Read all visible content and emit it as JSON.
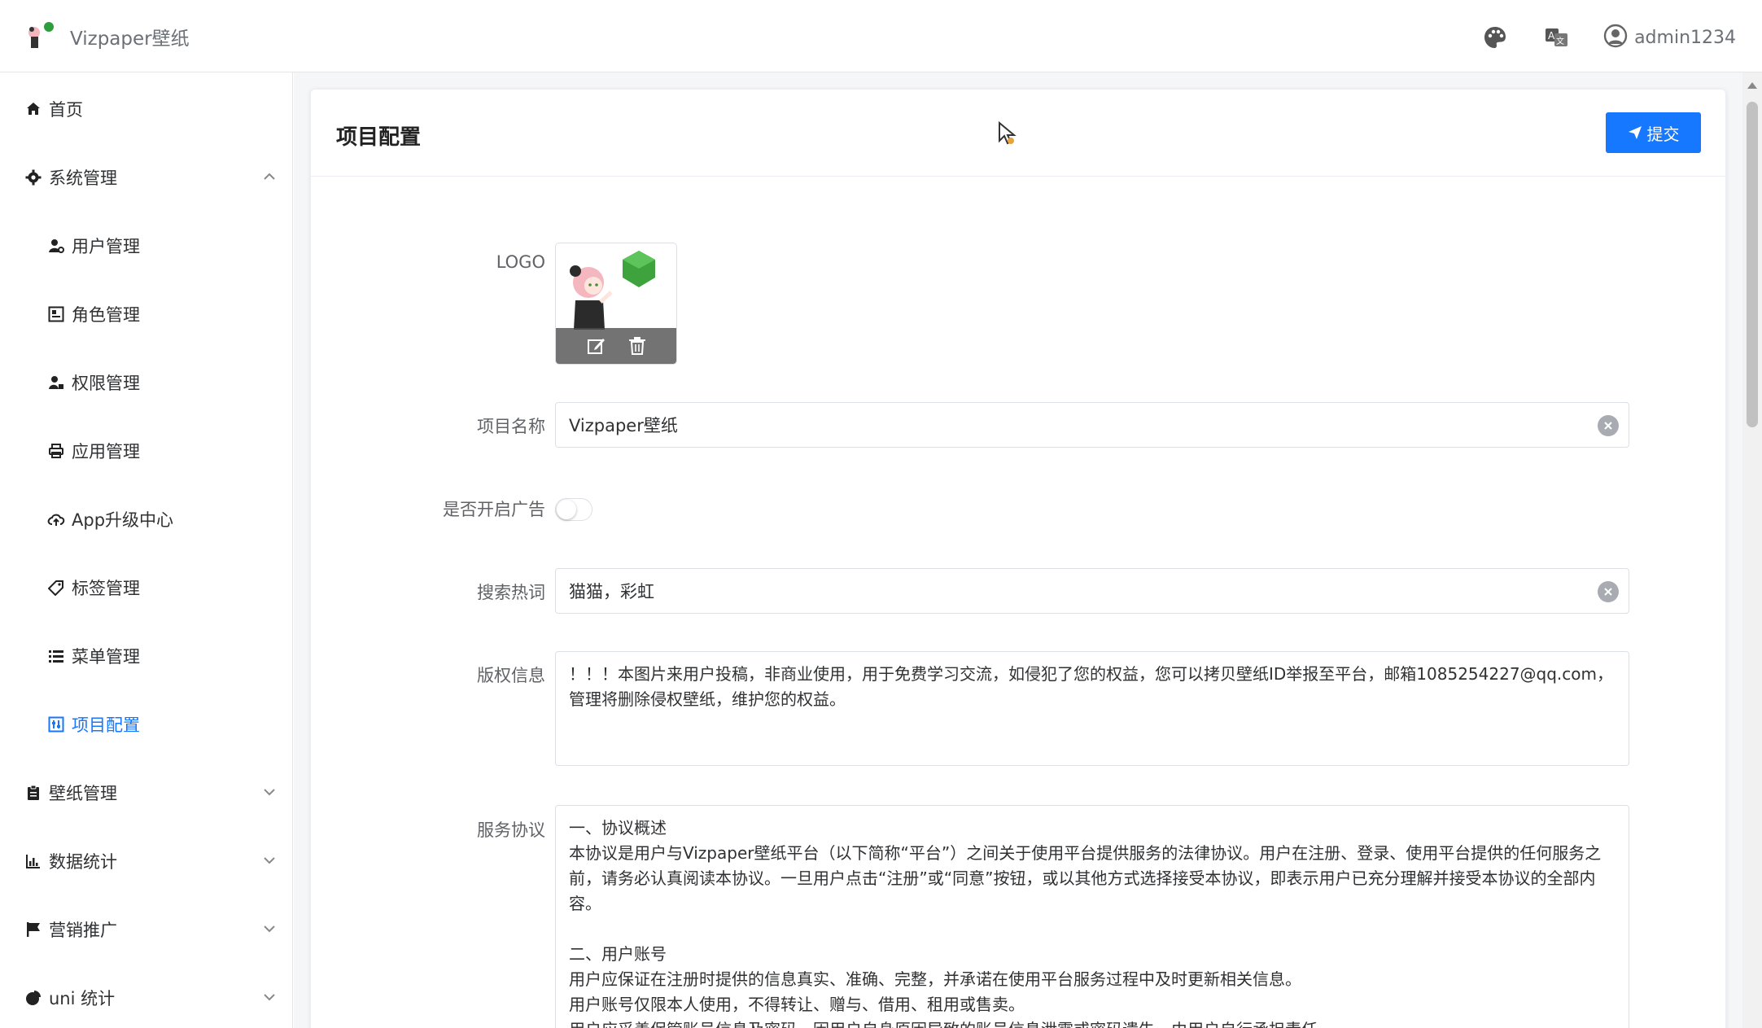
{
  "header": {
    "brand_title": "Vizpaper壁纸",
    "user_name": "admin1234"
  },
  "sidebar": {
    "items": [
      {
        "label": "首页",
        "icon": "home-icon"
      },
      {
        "label": "系统管理",
        "icon": "gear-icon",
        "expanded": true
      },
      {
        "label": "用户管理",
        "icon": "user-gear-icon"
      },
      {
        "label": "角色管理",
        "icon": "role-card-icon"
      },
      {
        "label": "权限管理",
        "icon": "user-lock-icon"
      },
      {
        "label": "应用管理",
        "icon": "printer-icon"
      },
      {
        "label": "App升级中心",
        "icon": "cloud-upload-icon"
      },
      {
        "label": "标签管理",
        "icon": "tag-icon"
      },
      {
        "label": "菜单管理",
        "icon": "list-icon"
      },
      {
        "label": "项目配置",
        "icon": "sliders-icon",
        "active": true
      },
      {
        "label": "壁纸管理",
        "icon": "clipboard-icon",
        "expanded": false
      },
      {
        "label": "数据统计",
        "icon": "bar-chart-icon",
        "expanded": false
      },
      {
        "label": "营销推广",
        "icon": "flag-icon",
        "expanded": false
      },
      {
        "label": "uni 统计",
        "icon": "pie-chart-icon",
        "expanded": false
      }
    ]
  },
  "page": {
    "title": "项目配置",
    "submit_label": "提交",
    "accent_color": "#1677ff"
  },
  "form": {
    "logo_label": "LOGO",
    "project_name_label": "项目名称",
    "project_name_value": "Vizpaper壁纸",
    "ad_label": "是否开启广告",
    "ad_enabled": false,
    "hot_words_label": "搜索热词",
    "hot_words_value": "猫猫，彩虹",
    "copyright_label": "版权信息",
    "copyright_value": "！！！本图片来用户投稿，非商业使用，用于免费学习交流，如侵犯了您的权益，您可以拷贝壁纸ID举报至平台，邮箱1085254227@qq.com，管理将删除侵权壁纸，维护您的权益。",
    "agreement_label": "服务协议",
    "agreement_value": "一、协议概述\n本协议是用户与Vizpaper壁纸平台（以下简称“平台”）之间关于使用平台提供服务的法律协议。用户在注册、登录、使用平台提供的任何服务之前，请务必认真阅读本协议。一旦用户点击“注册”或“同意”按钮，或以其他方式选择接受本协议，即表示用户已充分理解并接受本协议的全部内容。\n\n二、用户账号\n用户应保证在注册时提供的信息真实、准确、完整，并承诺在使用平台服务过程中及时更新相关信息。\n用户账号仅限本人使用，不得转让、赠与、借用、租用或售卖。\n用户应妥善保管账号信息及密码，因用户自身原因导致的账号信息泄露或密码遗失，由用户自行承担责任。"
  }
}
